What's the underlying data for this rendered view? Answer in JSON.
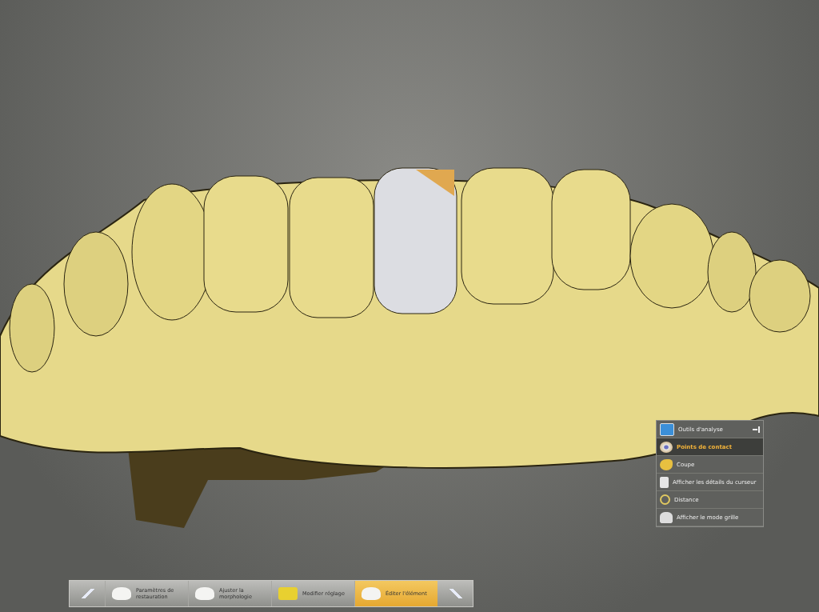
{
  "analysis_panel": {
    "title": "Outils d'analyse",
    "items": [
      {
        "label": "Points de contact",
        "selected": true
      },
      {
        "label": "Coupe",
        "selected": false
      },
      {
        "label": "Afficher les détails du curseur",
        "selected": false
      },
      {
        "label": "Distance",
        "selected": false
      },
      {
        "label": "Afficher le mode grille",
        "selected": false
      }
    ]
  },
  "workflow": {
    "steps": [
      {
        "label": "Paramètres de restauration",
        "selected": false
      },
      {
        "label": "Ajuster la morphologie",
        "selected": false
      },
      {
        "label": "Modifier réglage",
        "selected": false
      },
      {
        "label": "Éditer l'élément",
        "selected": true
      }
    ]
  }
}
